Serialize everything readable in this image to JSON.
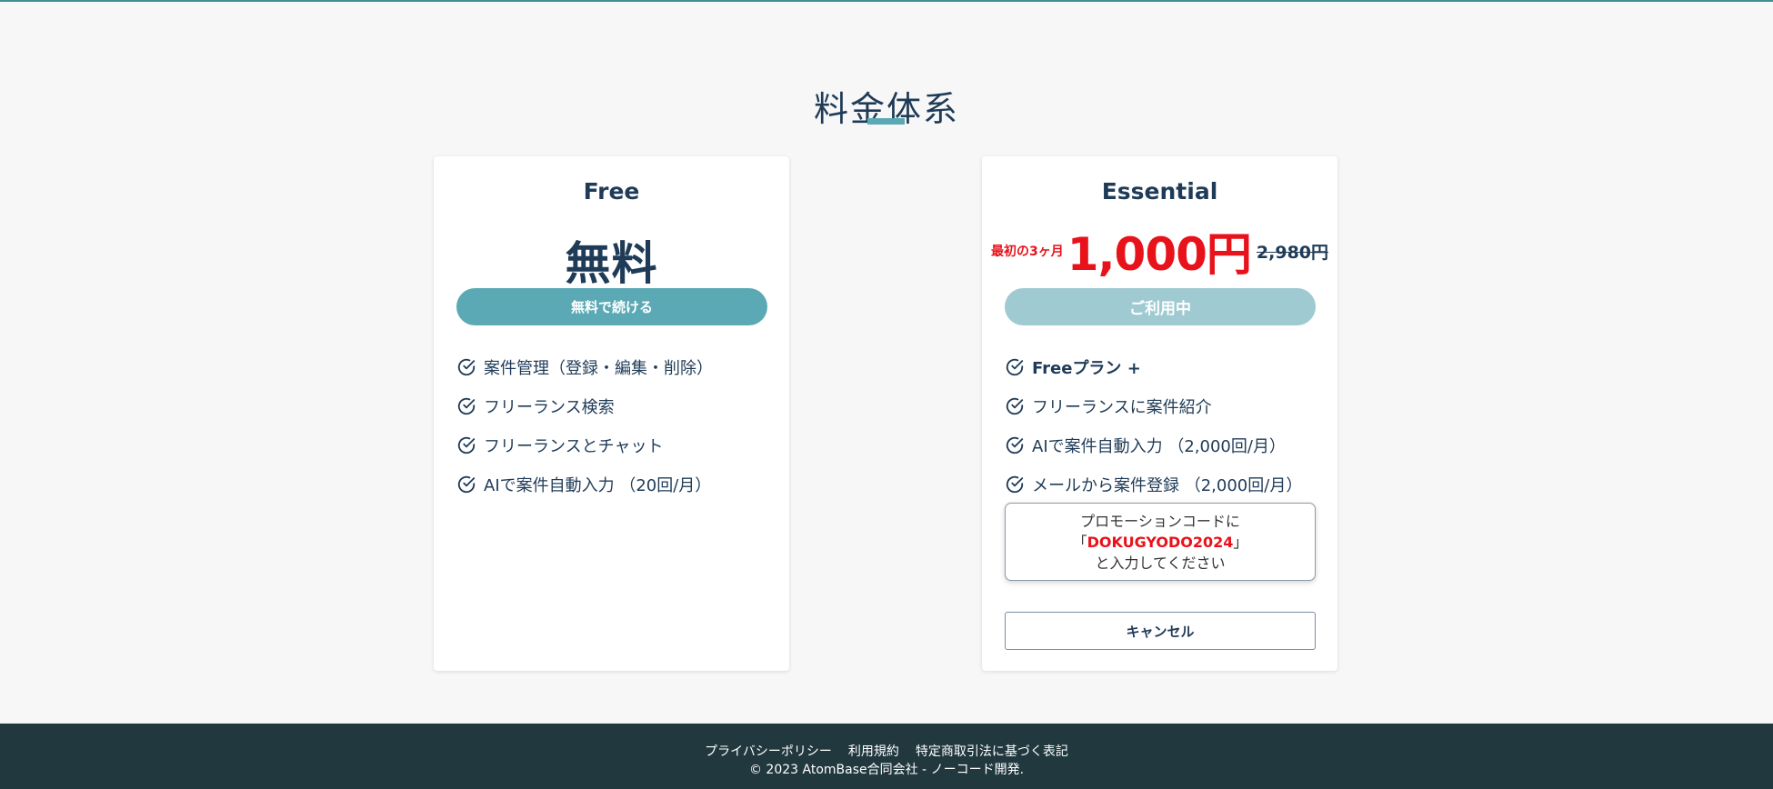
{
  "page": {
    "title": "料金体系"
  },
  "colors": {
    "accent": "#5aa9b4",
    "accent_light": "#9fcad1",
    "promo_red": "#e8121b",
    "text_navy": "#1f3b57",
    "footer_bg": "#21383f"
  },
  "plans": {
    "free": {
      "name": "Free",
      "price": "無料",
      "button_label": "無料で続ける",
      "features": [
        "案件管理（登録・編集・削除）",
        "フリーランス検索",
        "フリーランスとチャット",
        "AIで案件自動入力 （20回/月）"
      ],
      "feature_icon": "check-circle-icon"
    },
    "essential": {
      "name": "Essential",
      "promo_prefix": "最初の3ヶ月",
      "promo_price": "1,000円",
      "original_price": "2,980円",
      "button_label": "ご利用中",
      "features": [
        "Freeプラン +",
        "フリーランスに案件紹介",
        "AIで案件自動入力 （2,000回/月）",
        "メールから案件登録 （2,000回/月）"
      ],
      "feature_icon": "check-circle-icon",
      "promo_box": {
        "line1": "プロモーションコードに",
        "code_open": "「",
        "code": "DOKUGYODO2024",
        "code_close": "」",
        "line3": "と入力してください"
      },
      "cancel_label": "キャンセル"
    }
  },
  "footer": {
    "links": [
      "プライバシーポリシー",
      "利用規約",
      "特定商取引法に基づく表記"
    ],
    "copyright": "© 2023 AtomBase合同会社 - ノーコード開発."
  }
}
